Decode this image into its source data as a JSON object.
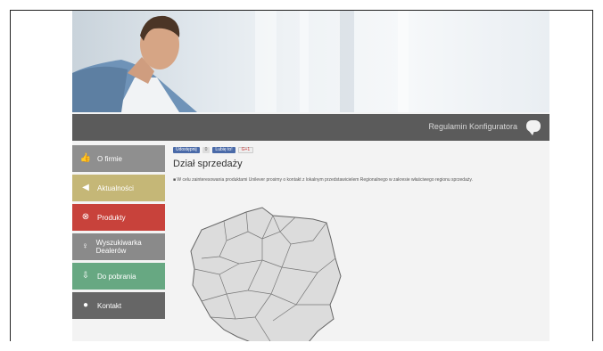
{
  "topbar": {
    "regulations_link": "Regulamin Konfiguratora"
  },
  "nav": {
    "items": [
      {
        "label": "O firmie",
        "icon": "thumbs-up-icon",
        "color": "#8f8f8f"
      },
      {
        "label": "Aktualności",
        "icon": "megaphone-icon",
        "color": "#c5b777"
      },
      {
        "label": "Produkty",
        "icon": "product-icon",
        "color": "#c8423b"
      },
      {
        "label": "Wyszukiwarka Dealerów",
        "icon": "lightbulb-icon",
        "color": "#8a8a8a"
      },
      {
        "label": "Do pobrania",
        "icon": "download-icon",
        "color": "#67a882"
      },
      {
        "label": "Kontakt",
        "icon": "location-pin-icon",
        "color": "#666666"
      }
    ]
  },
  "content": {
    "social": {
      "facebook": "Udostępnij",
      "like": "Lubię to!",
      "gplus": "G+1",
      "count": "0"
    },
    "title": "Dział sprzedaży",
    "note": "W celu zainteresowania produktami Unilever prosimy o kontakt z lokalnym przedstawicielem Regionalnego w zakresie właściwego regionu sprzedaży.",
    "map_label": "Mapa województw"
  },
  "colors": {
    "topbar": "#5b5b5b",
    "facebook_blue": "#4a6aa8"
  }
}
